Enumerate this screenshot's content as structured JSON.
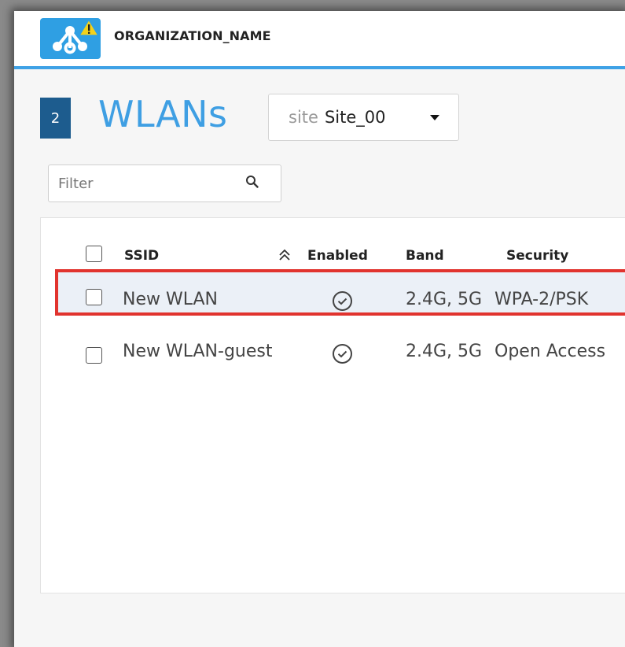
{
  "header": {
    "org_name": "ORGANIZATION_NAME",
    "brand_color": "#2f9fe3",
    "accent_color": "#3fa2e6"
  },
  "page": {
    "count": "2",
    "title": "WLANs"
  },
  "site_selector": {
    "label": "site",
    "value": "Site_00"
  },
  "filter": {
    "placeholder": "Filter",
    "value": ""
  },
  "table": {
    "columns": [
      "SSID",
      "Enabled",
      "Band",
      "Security"
    ],
    "sort_column": "SSID",
    "rows": [
      {
        "ssid": "New WLAN",
        "enabled": true,
        "band": "2.4G, 5G",
        "security": "WPA-2/PSK",
        "selected": true,
        "highlight_color": "#e1332e"
      },
      {
        "ssid": "New WLAN-guest",
        "enabled": true,
        "band": "2.4G, 5G",
        "security": "Open Access",
        "selected": false
      }
    ]
  },
  "icons": {
    "logo": "network-warning-logo-icon",
    "search": "search-icon",
    "sort": "sort-up-icon",
    "enabled": "check-circle-icon",
    "dropdown": "caret-down-icon"
  }
}
